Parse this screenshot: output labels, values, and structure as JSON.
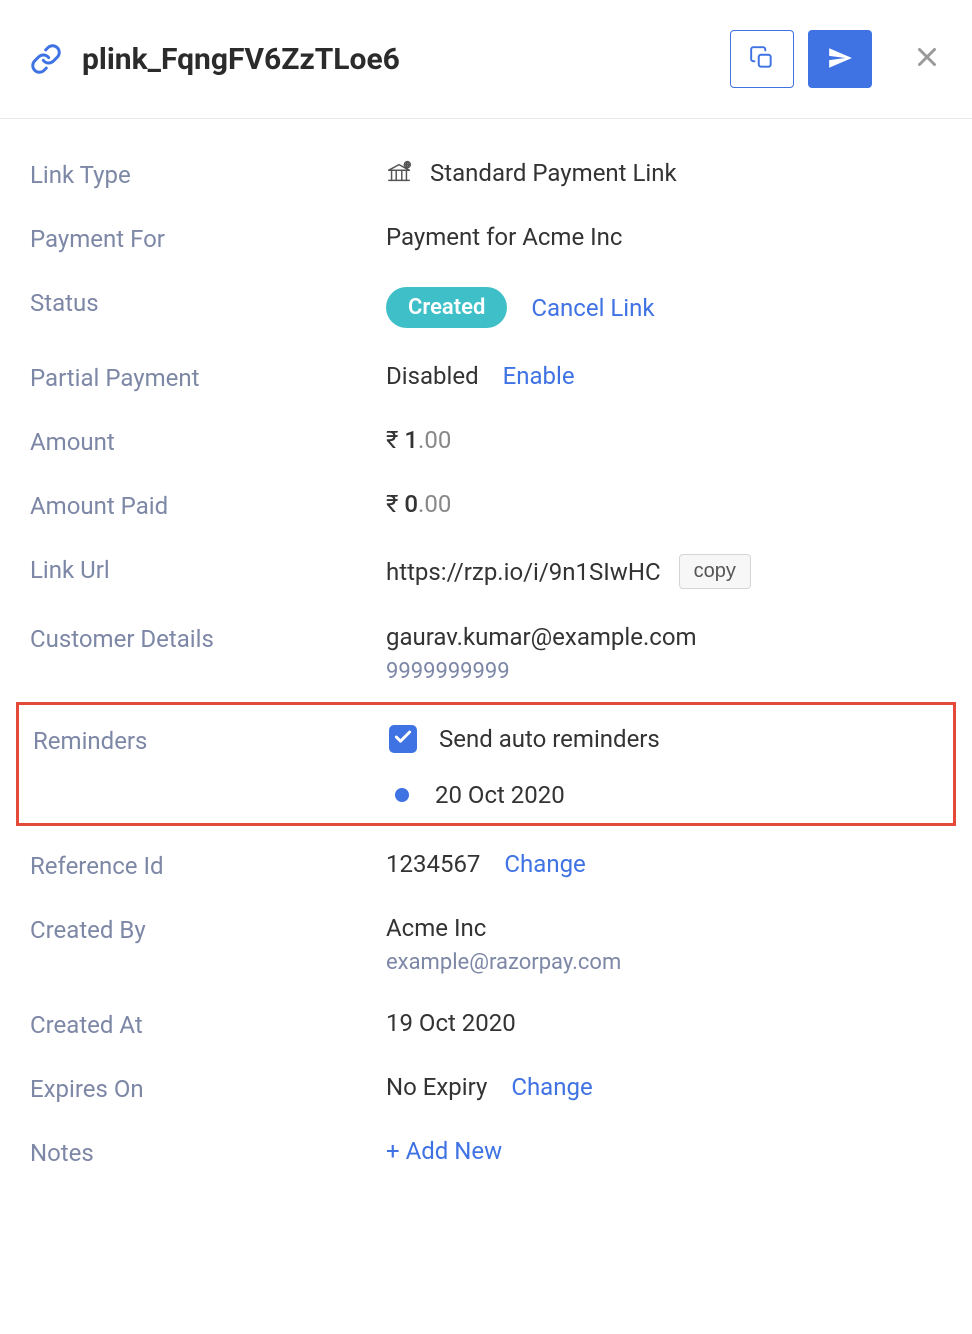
{
  "header": {
    "title": "plink_FqngFV6ZzTLoe6"
  },
  "fields": {
    "linkType": {
      "label": "Link Type",
      "value": "Standard Payment Link"
    },
    "paymentFor": {
      "label": "Payment For",
      "value": "Payment for Acme Inc"
    },
    "status": {
      "label": "Status",
      "badge": "Created",
      "action": "Cancel Link"
    },
    "partialPayment": {
      "label": "Partial Payment",
      "value": "Disabled",
      "action": "Enable"
    },
    "amount": {
      "label": "Amount",
      "currency": "₹",
      "main": "1",
      "decimal": ".00"
    },
    "amountPaid": {
      "label": "Amount Paid",
      "currency": "₹",
      "main": "0",
      "decimal": ".00"
    },
    "linkUrl": {
      "label": "Link Url",
      "value": "https://rzp.io/i/9n1SIwHC",
      "copyLabel": "copy"
    },
    "customerDetails": {
      "label": "Customer Details",
      "email": "gaurav.kumar@example.com",
      "phone": "9999999999"
    },
    "reminders": {
      "label": "Reminders",
      "checkboxLabel": "Send auto reminders",
      "date": "20 Oct 2020"
    },
    "referenceId": {
      "label": "Reference Id",
      "value": "1234567",
      "action": "Change"
    },
    "createdBy": {
      "label": "Created By",
      "name": "Acme Inc",
      "email": "example@razorpay.com"
    },
    "createdAt": {
      "label": "Created At",
      "value": "19 Oct 2020"
    },
    "expiresOn": {
      "label": "Expires On",
      "value": "No Expiry",
      "action": "Change"
    },
    "notes": {
      "label": "Notes",
      "action": "+ Add New"
    }
  }
}
